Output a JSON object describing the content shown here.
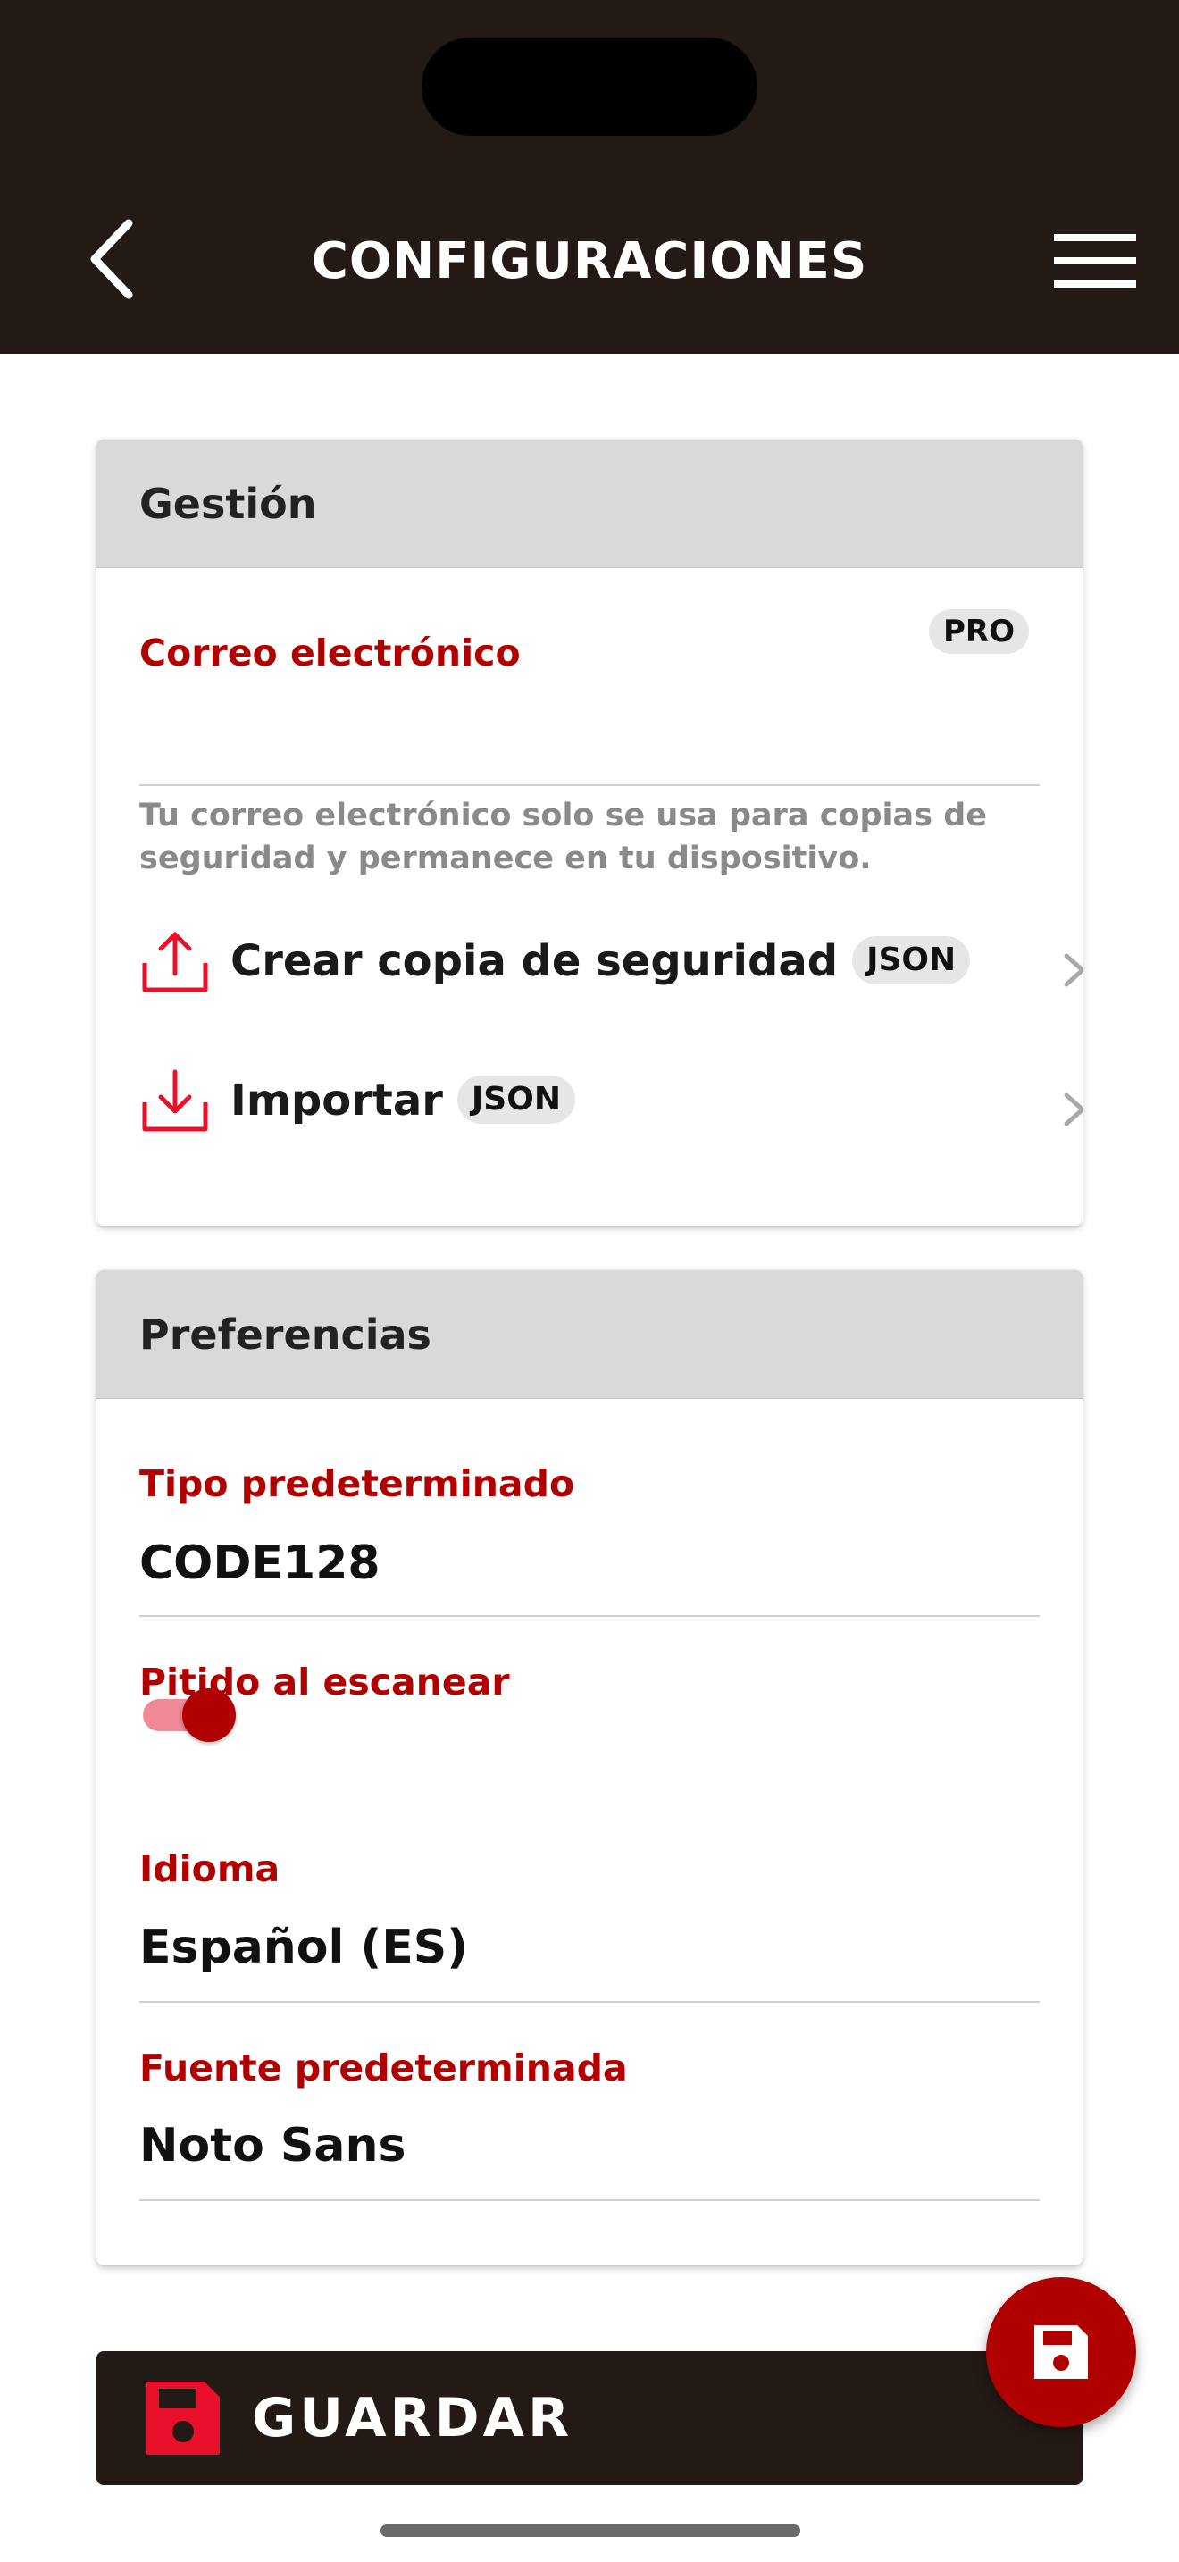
{
  "header": {
    "title": "CONFIGURACIONES"
  },
  "gestion": {
    "title": "Gestión",
    "email_label": "Correo electrónico",
    "email_value": "",
    "pro_badge": "PRO",
    "helper": "Tu correo electrónico solo se usa para copias de seguridad y permanece en tu dispositivo.",
    "backup_label": "Crear copia de seguridad",
    "backup_badge": "JSON",
    "import_label": "Importar",
    "import_badge": "JSON"
  },
  "preferencias": {
    "title": "Preferencias",
    "type_label": "Tipo predeterminado",
    "type_value": "CODE128",
    "beep_label": "Pitido al escanear",
    "beep_enabled": true,
    "language_label": "Idioma",
    "language_value": "Español (ES)",
    "font_label": "Fuente predeterminada",
    "font_value": "Noto Sans"
  },
  "save": {
    "label": "GUARDAR"
  },
  "colors": {
    "header_bg": "#231a16",
    "accent_red": "#b00000",
    "icon_red": "#e8102a",
    "toggle_track": "#f08a97"
  },
  "icons": {
    "back": "chevron-left-icon",
    "menu": "hamburger-menu-icon",
    "backup": "upload-icon",
    "import": "download-icon",
    "row_chevron": "chevron-right-icon",
    "save": "floppy-disk-icon"
  }
}
